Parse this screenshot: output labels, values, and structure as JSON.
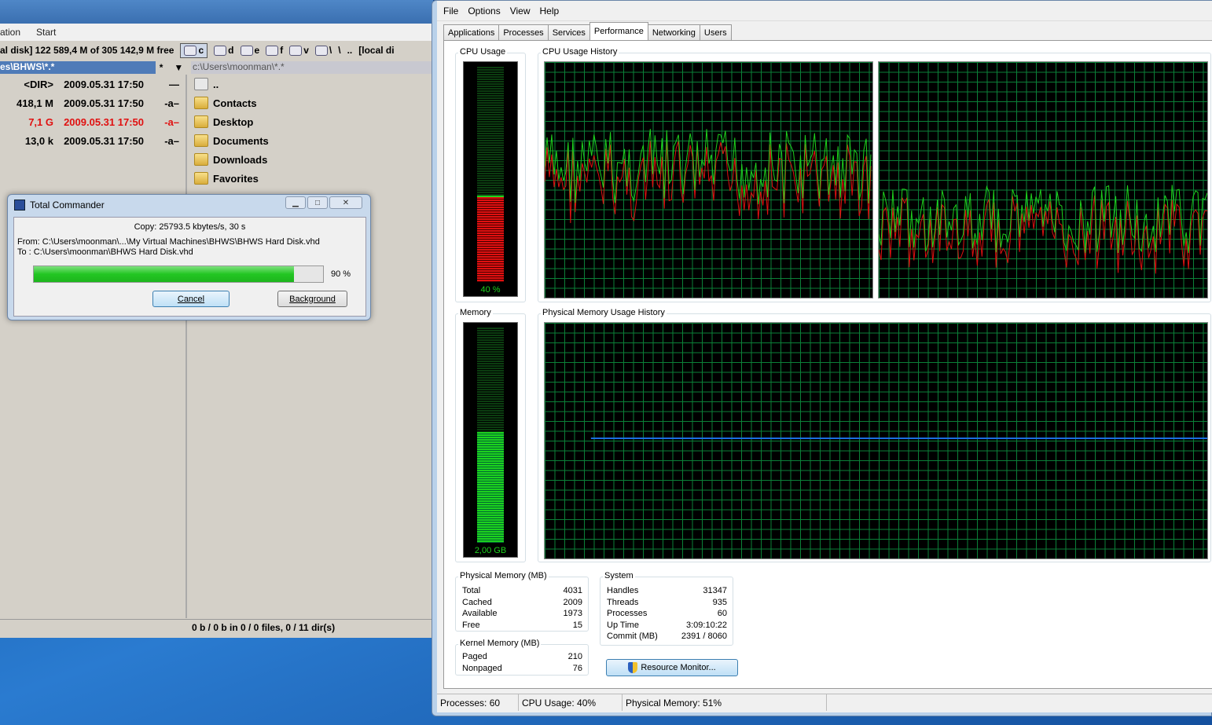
{
  "tc": {
    "menu": [
      "ation",
      "Start"
    ],
    "drive_info": "al disk]  122 589,4 M of 305 142,9 M free",
    "drives": [
      "c",
      "d",
      "e",
      "f",
      "v",
      "\\"
    ],
    "root_btn": "\\",
    "parent_btn": "..",
    "drive_info_right": "[local di",
    "left": {
      "path": "es\\BHWS\\*.*",
      "history": "*",
      "rows": [
        {
          "size": "<DIR>",
          "date": "2009.05.31 17:50",
          "attr": "—"
        },
        {
          "size": "418,1 M",
          "date": "2009.05.31 17:50",
          "attr": "-a–"
        },
        {
          "size": "7,1 G",
          "date": "2009.05.31 17:50",
          "attr": "-a–"
        },
        {
          "size": "13,0 k",
          "date": "2009.05.31 17:50",
          "attr": "-a–"
        }
      ]
    },
    "right": {
      "path": "c:\\Users\\moonman\\*.*",
      "rows": [
        "..",
        "Contacts",
        "Desktop",
        "Documents",
        "Downloads",
        "Favorites"
      ]
    },
    "status": "0 b / 0 b in 0 / 0 files, 0 / 11 dir(s)"
  },
  "dialog": {
    "title": "Total Commander",
    "copy_info": "Copy: 25793.5 kbytes/s, 30 s",
    "from": "From:  C:\\Users\\moonman\\...\\My Virtual Machines\\BHWS\\BHWS Hard Disk.vhd",
    "to": "To  : C:\\Users\\moonman\\BHWS Hard Disk.vhd",
    "progress": 0.9,
    "percent": "90 %",
    "cancel_label": "Cancel",
    "background_label": "Background"
  },
  "tm": {
    "menu": [
      "File",
      "Options",
      "View",
      "Help"
    ],
    "tabs": [
      "Applications",
      "Processes",
      "Services",
      "Performance",
      "Networking",
      "Users"
    ],
    "perf": {
      "cpu_usage_label": "CPU Usage",
      "cpu_usage_text": "40 %",
      "cpu_usage_fraction": 0.4,
      "cpu_history_label": "CPU Usage History",
      "memory_label": "Memory",
      "memory_text": "2,00 GB",
      "memory_fraction": 0.51,
      "memory_history_label": "Physical Memory Usage History"
    },
    "phys": {
      "heading": "Physical Memory (MB)",
      "rows": [
        {
          "label": "Total",
          "value": "4031"
        },
        {
          "label": "Cached",
          "value": "2009"
        },
        {
          "label": "Available",
          "value": "1973"
        },
        {
          "label": "Free",
          "value": "15"
        }
      ]
    },
    "kernel": {
      "heading": "Kernel Memory (MB)",
      "rows": [
        {
          "label": "Paged",
          "value": "210"
        },
        {
          "label": "Nonpaged",
          "value": "76"
        }
      ]
    },
    "system": {
      "heading": "System",
      "rows": [
        {
          "label": "Handles",
          "value": "31347"
        },
        {
          "label": "Threads",
          "value": "935"
        },
        {
          "label": "Processes",
          "value": "60"
        },
        {
          "label": "Up Time",
          "value": "3:09:10:22"
        },
        {
          "label": "Commit (MB)",
          "value": "2391 / 8060"
        }
      ]
    },
    "resource_monitor_label": "Resource Monitor...",
    "status": [
      "Processes: 60",
      "CPU Usage: 40%",
      "Physical Memory: 51%"
    ],
    "colors": {
      "graph_green": "#1dd21d",
      "graph_red": "#e01010",
      "memory_line": "#1a6ee0",
      "grid": "#0b8038"
    }
  }
}
